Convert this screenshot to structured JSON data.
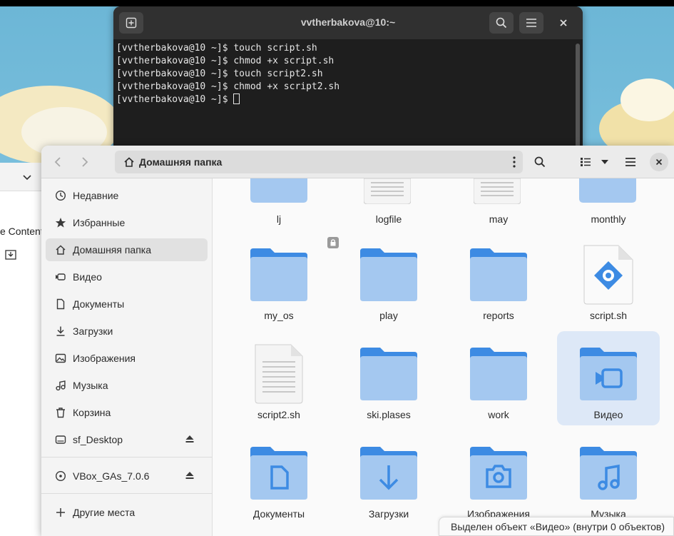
{
  "terminal": {
    "title": "vvtherbakova@10:~",
    "lines": [
      "[vvtherbakova@10 ~]$ touch script.sh",
      "[vvtherbakova@10 ~]$ chmod +x script.sh",
      "[vvtherbakova@10 ~]$ touch script2.sh",
      "[vvtherbakova@10 ~]$ chmod +x script2.sh"
    ],
    "prompt": "[vvtherbakova@10 ~]$ "
  },
  "background_window": {
    "partial_text": "e Content"
  },
  "file_manager": {
    "path_label": "Домашняя папка",
    "sidebar": [
      {
        "label": "Недавние",
        "icon": "clock-icon"
      },
      {
        "label": "Избранные",
        "icon": "star-icon"
      },
      {
        "label": "Домашняя папка",
        "icon": "home-icon",
        "active": true
      },
      {
        "label": "Видео",
        "icon": "video-icon"
      },
      {
        "label": "Документы",
        "icon": "document-icon"
      },
      {
        "label": "Загрузки",
        "icon": "download-icon"
      },
      {
        "label": "Изображения",
        "icon": "image-icon"
      },
      {
        "label": "Музыка",
        "icon": "music-icon"
      },
      {
        "label": "Корзина",
        "icon": "trash-icon"
      },
      {
        "label": "sf_Desktop",
        "icon": "drive-icon",
        "eject": true
      },
      {
        "label": "VBox_GAs_7.0.6",
        "icon": "disc-icon",
        "eject": true
      },
      {
        "label": "Другие места",
        "icon": "plus-icon"
      }
    ],
    "top_row_labels": [
      "lj",
      "logfile",
      "may",
      "monthly"
    ],
    "files": [
      {
        "name": "my_os",
        "type": "folder",
        "locked": true
      },
      {
        "name": "play",
        "type": "folder"
      },
      {
        "name": "reports",
        "type": "folder"
      },
      {
        "name": "script.sh",
        "type": "script"
      },
      {
        "name": "script2.sh",
        "type": "text"
      },
      {
        "name": "ski.plases",
        "type": "folder"
      },
      {
        "name": "work",
        "type": "folder"
      },
      {
        "name": "Видео",
        "type": "folder-video",
        "selected": true
      },
      {
        "name": "Документы",
        "type": "folder-documents"
      },
      {
        "name": "Загрузки",
        "type": "folder-downloads"
      },
      {
        "name": "Изображения",
        "type": "folder-pictures"
      },
      {
        "name": "Музыка",
        "type": "folder-music"
      }
    ],
    "status": "Выделен объект «Видео» (внутри 0 объектов)",
    "colors": {
      "folder_light": "#a4c8f0",
      "folder_dark": "#3d8be3",
      "selection": "#dde8f7",
      "accent": "#3584e4"
    }
  }
}
